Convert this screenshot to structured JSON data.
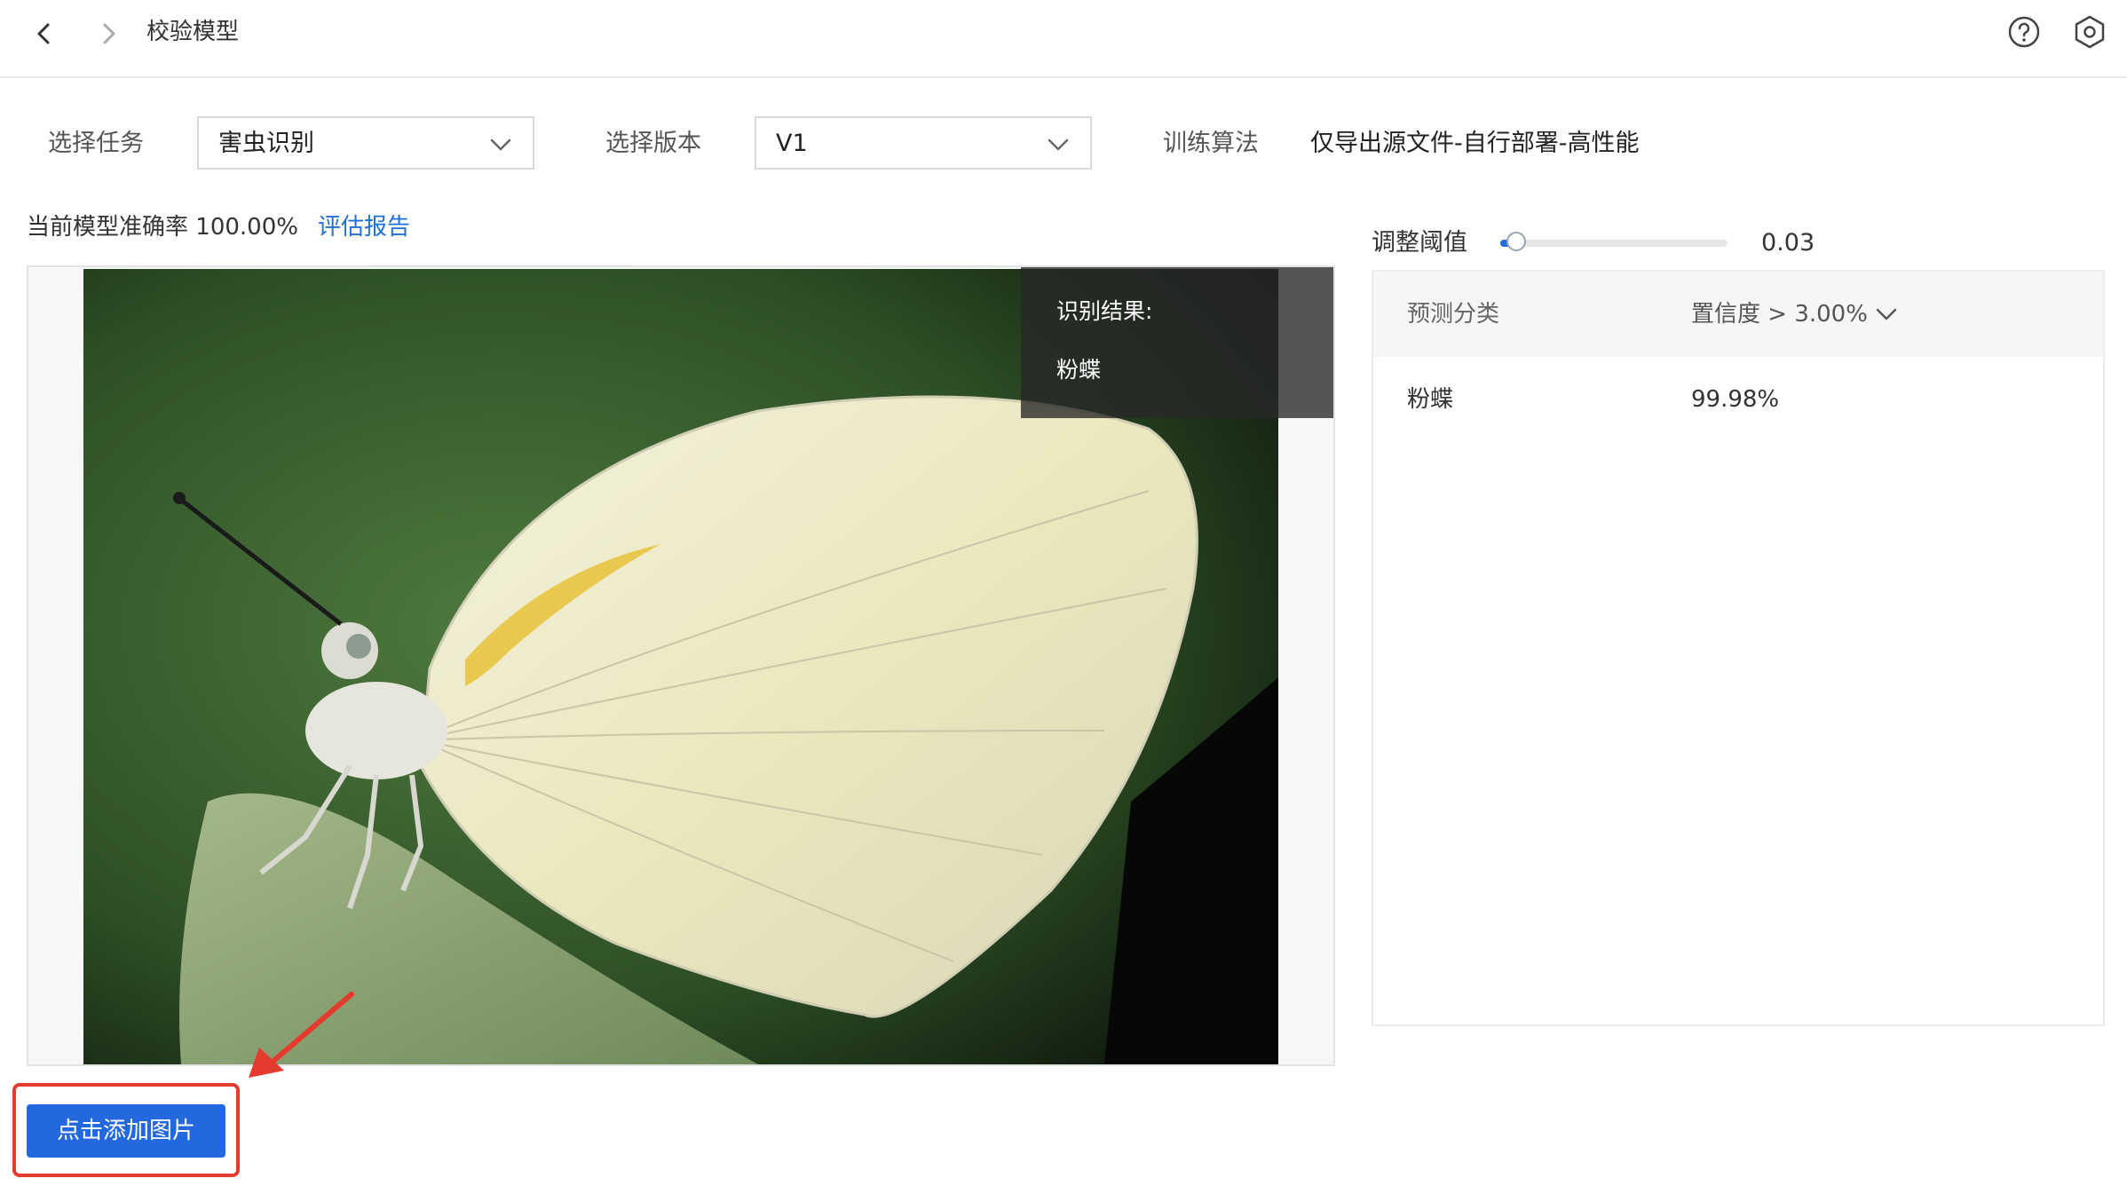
{
  "header": {
    "title": "校验模型",
    "back_icon": "chevron-left-icon",
    "forward_icon": "chevron-right-icon",
    "help_icon": "question-circle-icon",
    "settings_icon": "gear-hexagon-icon"
  },
  "filters": {
    "task_label": "选择任务",
    "task_value": "害虫识别",
    "version_label": "选择版本",
    "version_value": "V1",
    "algo_label": "训练算法",
    "algo_value": "仅导出源文件-自行部署-高性能"
  },
  "accuracy": {
    "label": "当前模型准确率",
    "value": "100.00%",
    "report_link": "评估报告"
  },
  "preview": {
    "result_title": "识别结果:",
    "result_value": "粉蝶"
  },
  "threshold": {
    "label": "调整阈值",
    "value": "0.03",
    "slider_fraction": 0.03
  },
  "results": {
    "col_class": "预测分类",
    "col_confidence": "置信度 > 3.00%",
    "rows": [
      {
        "class": "粉蝶",
        "confidence": "99.98%"
      }
    ]
  },
  "actions": {
    "add_image": "点击添加图片"
  },
  "colors": {
    "accent": "#2468e0",
    "link": "#1e6fd9",
    "highlight": "#e53b2f"
  }
}
